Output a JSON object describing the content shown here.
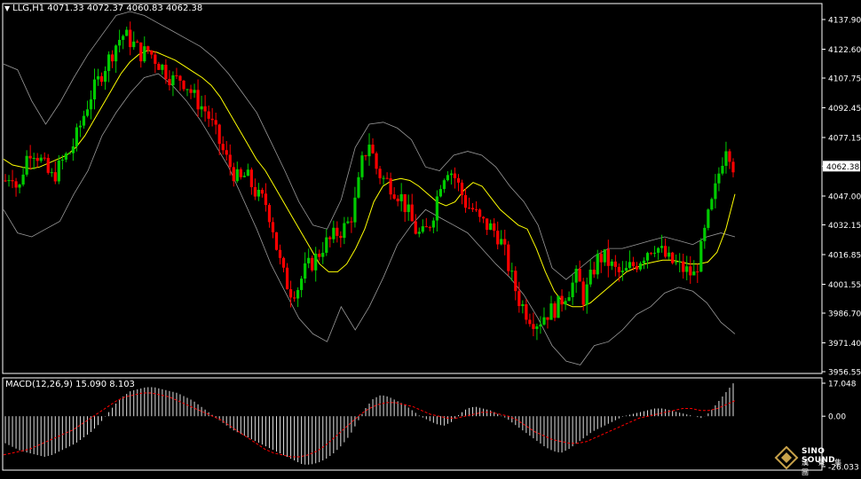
{
  "header": {
    "symbol": "LLG,H1",
    "values": "4071.33 4072.37 4060.83 4062.38"
  },
  "macd_header": "MACD(12,26,9) 15.090 8.103",
  "logo": {
    "name": "SINO SOUND",
    "cn": "漢 聲 集 團"
  },
  "colors": {
    "background": "#000000",
    "bull": "#00cc00",
    "bear": "#ff0000",
    "ma": "#ffff00",
    "bands": "#9a9a9a",
    "frame": "#ffffff",
    "signal": "#ff0000"
  },
  "chart_data": [
    {
      "type": "candlestick",
      "ylim": [
        3956.55,
        4137.9
      ],
      "yticks": [
        "4137.90",
        "4122.60",
        "4107.75",
        "4092.45",
        "4077.15",
        "4062.38",
        "4047.00",
        "4032.15",
        "4016.85",
        "4001.55",
        "3986.70",
        "3971.40",
        "3956.55"
      ],
      "yticks_values": [
        4137.9,
        4122.6,
        4107.75,
        4092.45,
        4077.15,
        4062.38,
        4047.0,
        4032.15,
        4016.85,
        4001.55,
        3986.7,
        3971.4,
        3956.55
      ],
      "current_price_label": "4062.38",
      "price_path": [
        4055,
        4060,
        4048,
        4065,
        4072,
        4068,
        4062,
        4056,
        4060,
        4066,
        4070,
        4078,
        4088,
        4098,
        4104,
        4112,
        4118,
        4125,
        4130,
        4128,
        4124,
        4120,
        4122,
        4118,
        4114,
        4110,
        4106,
        4108,
        4104,
        4098,
        4094,
        4090,
        4082,
        4074,
        4066,
        4060,
        4054,
        4058,
        4052,
        4046,
        4044,
        4034,
        4016,
        4004,
        3998,
        4000,
        4008,
        4012,
        4016,
        4022,
        4024,
        4028,
        4030,
        4034,
        4046,
        4066,
        4075,
        4062,
        4056,
        4054,
        4050,
        4046,
        4038,
        4030,
        4026,
        4030,
        4040,
        4055,
        4062,
        4058,
        4050,
        4042,
        4040,
        4034,
        4032,
        4030,
        4026,
        4016,
        4004,
        3994,
        3988,
        3984,
        3982,
        3986,
        3988,
        3990,
        3996,
        4000,
        4006,
        3994,
        4004,
        4014,
        4016,
        4012,
        4008,
        4006,
        4010,
        4012,
        4016,
        4020,
        4022,
        4018,
        4014,
        4012,
        4010,
        4008,
        4006,
        4018,
        4034,
        4046,
        4062,
        4075,
        4063
      ],
      "ma_path": [
        4066,
        4063,
        4062,
        4061,
        4062,
        4064,
        4066,
        4068,
        4072,
        4078,
        4086,
        4094,
        4102,
        4110,
        4116,
        4120,
        4122,
        4121,
        4119,
        4117,
        4114,
        4111,
        4108,
        4104,
        4098,
        4090,
        4082,
        4074,
        4066,
        4060,
        4052,
        4044,
        4036,
        4028,
        4020,
        4012,
        4008,
        4008,
        4012,
        4020,
        4030,
        4044,
        4052,
        4055,
        4056,
        4055,
        4052,
        4048,
        4044,
        4042,
        4044,
        4050,
        4054,
        4052,
        4046,
        4040,
        4036,
        4032,
        4030,
        4020,
        4008,
        3998,
        3992,
        3990,
        3990,
        3992,
        3996,
        4000,
        4004,
        4008,
        4010,
        4012,
        4013,
        4014,
        4014,
        4013,
        4012,
        4012,
        4013,
        4018,
        4030,
        4048
      ],
      "upper_band_path": [
        4115,
        4112,
        4096,
        4084,
        4095,
        4108,
        4120,
        4130,
        4140,
        4142,
        4140,
        4136,
        4132,
        4128,
        4124,
        4118,
        4110,
        4100,
        4090,
        4075,
        4060,
        4044,
        4032,
        4030,
        4045,
        4072,
        4084,
        4085,
        4082,
        4076,
        4062,
        4060,
        4068,
        4070,
        4068,
        4062,
        4052,
        4044,
        4032,
        4010,
        4004,
        4010,
        4016,
        4020,
        4020,
        4022,
        4024,
        4026,
        4024,
        4022,
        4026,
        4028,
        4026
      ],
      "lower_band_path": [
        4040,
        4028,
        4026,
        4030,
        4034,
        4048,
        4060,
        4078,
        4090,
        4100,
        4108,
        4110,
        4104,
        4096,
        4086,
        4074,
        4062,
        4046,
        4030,
        4012,
        3998,
        3984,
        3976,
        3972,
        3990,
        3978,
        3990,
        4005,
        4022,
        4032,
        4040,
        4036,
        4032,
        4028,
        4020,
        4012,
        4005,
        3996,
        3984,
        3970,
        3962,
        3960,
        3970,
        3972,
        3978,
        3986,
        3990,
        3997,
        4000,
        3998,
        3992,
        3982,
        3976
      ]
    },
    {
      "type": "bar",
      "title": "MACD(12,26,9) 15.090 8.103",
      "ylim": [
        -26.033,
        17.048
      ],
      "yticks": [
        "17.048",
        "0.00",
        "-26.033"
      ],
      "yticks_values": [
        17.048,
        0.0,
        -26.033
      ],
      "values": [
        -14,
        -16,
        -18,
        -19,
        -20,
        -21,
        -20,
        -18,
        -16,
        -14,
        -11,
        -8,
        -4,
        1,
        6,
        10,
        13,
        14,
        15,
        15,
        14,
        13,
        12,
        10,
        8,
        5,
        2,
        -1,
        -4,
        -7,
        -9,
        -11,
        -13,
        -15,
        -17,
        -19,
        -21,
        -23,
        -25,
        -25,
        -24,
        -22,
        -19,
        -15,
        -10,
        -3,
        4,
        9,
        11,
        10,
        8,
        6,
        3,
        0,
        -2,
        -4,
        -5,
        -3,
        1,
        4,
        5,
        4,
        3,
        1,
        -1,
        -4,
        -7,
        -10,
        -13,
        -16,
        -18,
        -19,
        -17,
        -14,
        -11,
        -8,
        -6,
        -4,
        -2,
        0,
        1,
        2,
        3,
        4,
        4,
        3,
        2,
        1,
        0,
        -1,
        2,
        7,
        12,
        17
      ],
      "signal": [
        -20,
        -19,
        -18,
        -17,
        -15,
        -13,
        -11,
        -9,
        -7,
        -4,
        -1,
        2,
        5,
        8,
        10,
        11,
        12,
        12,
        11,
        10,
        8,
        6,
        4,
        2,
        0,
        -2,
        -5,
        -8,
        -11,
        -14,
        -17,
        -19,
        -20,
        -21,
        -21,
        -20,
        -18,
        -15,
        -11,
        -7,
        -3,
        1,
        4,
        6,
        7,
        7,
        6,
        5,
        3,
        1,
        0,
        -1,
        -1,
        0,
        1,
        2,
        2,
        1,
        0,
        -2,
        -5,
        -8,
        -10,
        -12,
        -13,
        -14,
        -14,
        -13,
        -11,
        -9,
        -7,
        -5,
        -3,
        -1,
        0,
        1,
        2,
        3,
        4,
        4,
        3,
        3,
        4,
        6,
        8
      ]
    }
  ]
}
